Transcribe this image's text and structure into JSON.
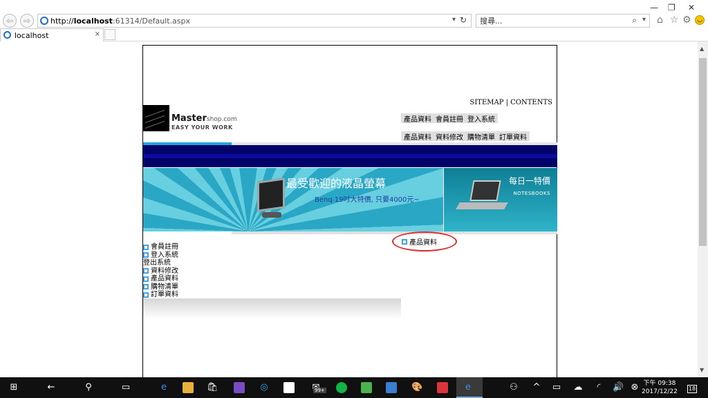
{
  "browser": {
    "url_prefix": "http://",
    "url_host": "localhost",
    "url_tail": ":61314/Default.aspx",
    "search_placeholder": "搜尋...",
    "tab_title": "localhost",
    "tab_close": "×"
  },
  "header": {
    "sitemap_text": "SITEMAP | CONTENTS",
    "brand_main": "Master",
    "brand_suffix": "shop.com",
    "tagline": "EASY YOUR WORK",
    "menu_top": [
      "產品資料",
      "會員註冊",
      "登入系統"
    ],
    "menu_bottom": [
      "產品資料",
      "資料修改",
      "購物清單",
      "訂單資料"
    ]
  },
  "banner": {
    "title": "最受歡迎的液晶螢幕",
    "subtitle": "Benq 19吋大特價, 只要4000元~",
    "right_title": "每日一特價",
    "right_sub": "NOTESBOOKS"
  },
  "category": {
    "label": "產品資料"
  },
  "side_menu": [
    {
      "label": "會員註冊",
      "bullet": true
    },
    {
      "label": "登入系統",
      "bullet": true
    },
    {
      "label": "登出系統",
      "bullet": false
    },
    {
      "label": "資料修改",
      "bullet": true
    },
    {
      "label": "產品資料",
      "bullet": true
    },
    {
      "label": "購物清單",
      "bullet": true
    },
    {
      "label": "訂單資料",
      "bullet": true
    }
  ],
  "taskbar": {
    "clock_time": "下午 09:38",
    "clock_date": "2017/12/22",
    "notification_count": "18",
    "badge_99": "99+"
  },
  "colors": {
    "accent_blue": "#1fa5d8",
    "navy": "#020268",
    "annotation_red": "#d92d2d"
  }
}
